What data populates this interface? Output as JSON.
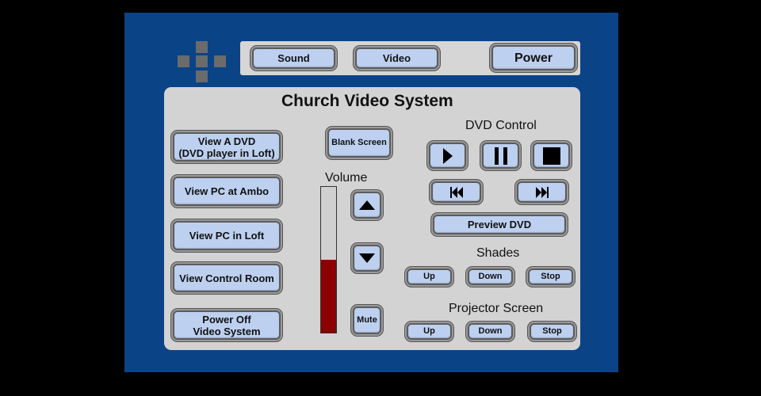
{
  "top_bar": {
    "sound_label": "Sound",
    "video_label": "Video",
    "power_label": "Power"
  },
  "main": {
    "title": "Church Video System",
    "sources": [
      {
        "label": "View A DVD\n(DVD player in Loft)"
      },
      {
        "label": "View PC at Ambo"
      },
      {
        "label": "View PC in Loft"
      },
      {
        "label": "View Control Room"
      },
      {
        "label": "Power Off\nVideo System"
      }
    ],
    "blank_screen_label": "Blank Screen",
    "volume": {
      "label": "Volume",
      "level_percent": 50,
      "mute_label": "Mute",
      "up_icon": "triangle-up",
      "down_icon": "triangle-down"
    },
    "dvd_control": {
      "label": "DVD Control",
      "buttons": [
        "play",
        "pause",
        "stop",
        "previous",
        "next"
      ],
      "preview_label": "Preview DVD"
    },
    "shades": {
      "label": "Shades",
      "up_label": "Up",
      "down_label": "Down",
      "stop_label": "Stop"
    },
    "projector_screen": {
      "label": "Projector Screen",
      "up_label": "Up",
      "down_label": "Down",
      "stop_label": "Stop"
    }
  },
  "colors": {
    "background": "#000000",
    "frame_blue": "#0b4387",
    "panel_gray": "#d3d3d3",
    "button_blue": "#bdd0f0",
    "volume_fill": "#8b0000"
  }
}
